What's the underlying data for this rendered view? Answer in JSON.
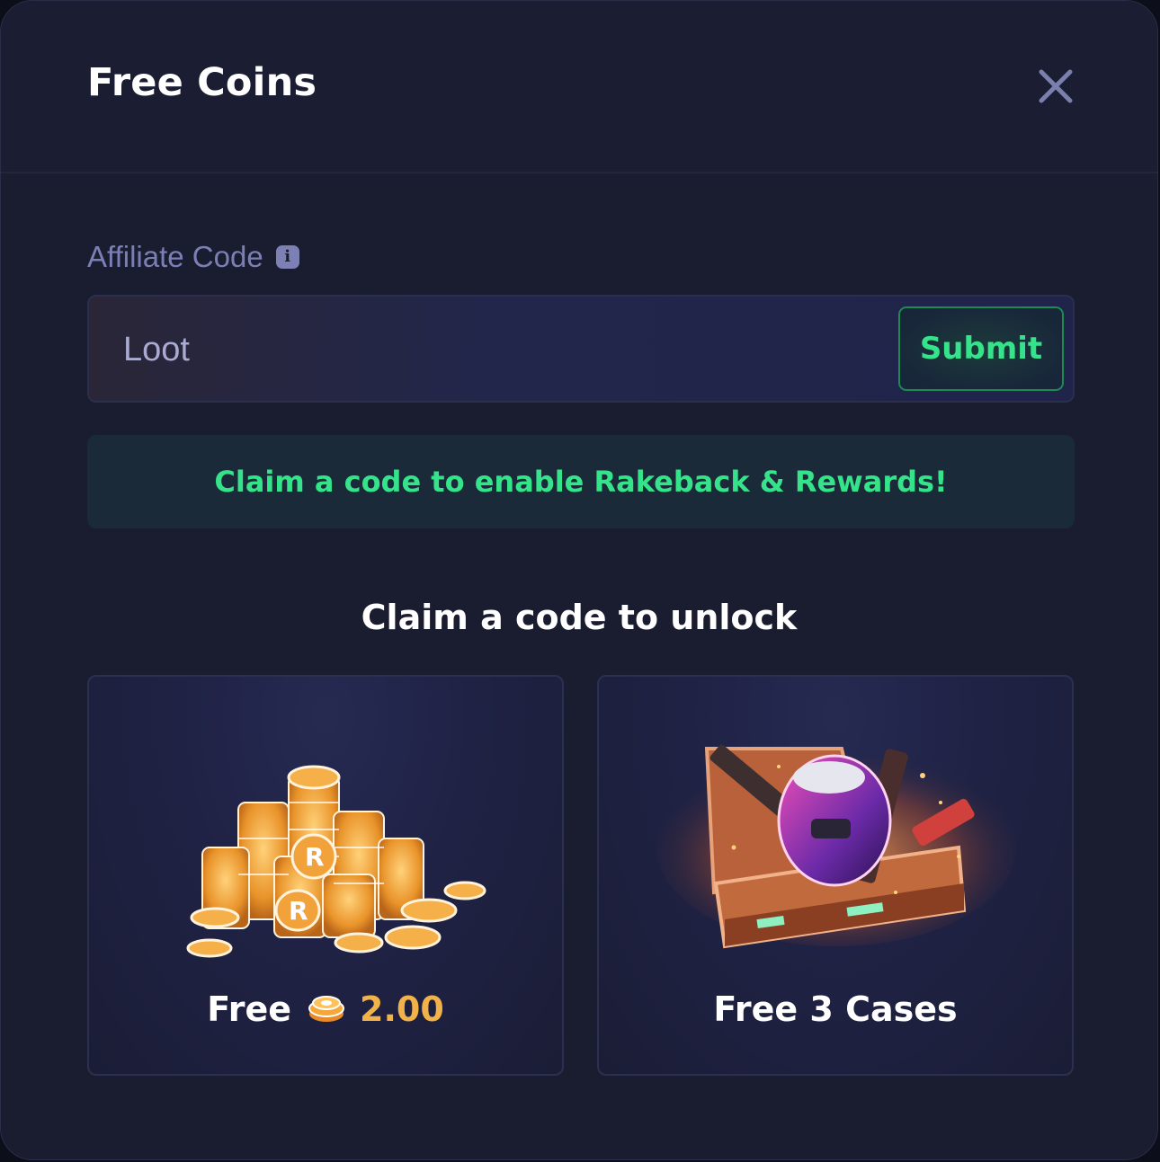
{
  "modal": {
    "title": "Free Coins",
    "close_icon": "close-icon"
  },
  "affiliate": {
    "label": "Affiliate Code",
    "info_icon": "info-icon",
    "input_value": "Loot",
    "submit_label": "Submit"
  },
  "banner": {
    "text": "Claim a code to enable Rakeback & Rewards!"
  },
  "unlock": {
    "title": "Claim a code to unlock",
    "cards": [
      {
        "art": "coin-stack-image",
        "prefix": "Free",
        "icon": "coin-icon",
        "amount": "2.00"
      },
      {
        "art": "weapon-case-image",
        "label": "Free 3 Cases"
      }
    ]
  },
  "colors": {
    "accent_green": "#34e38a",
    "coin_gold": "#f1b24a",
    "label_muted": "#7c7fb3",
    "background": "#1a1c30"
  }
}
